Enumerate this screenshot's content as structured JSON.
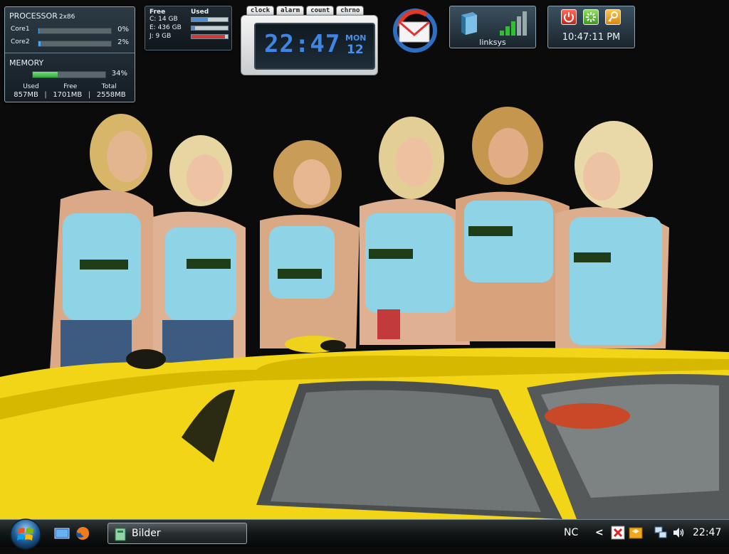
{
  "gadgets": {
    "cpu_meter": {
      "title": "PROCESSOR",
      "arch": "2x86",
      "cores": [
        {
          "label": "Core1",
          "percent": "0%",
          "value": 0
        },
        {
          "label": "Core2",
          "percent": "2%",
          "value": 2
        }
      ],
      "memory_title": "MEMORY",
      "memory_percent": "34%",
      "memory_value": 34,
      "used_label": "Used",
      "free_label": "Free",
      "total_label": "Total",
      "used": "857MB",
      "free": "1701MB",
      "total": "2558MB",
      "separator": "|"
    },
    "drive_meter": {
      "free_header": "Free",
      "used_header": "Used",
      "drives": [
        {
          "label": "C: 14 GB",
          "used_fraction": 0.45
        },
        {
          "label": "E: 436 GB",
          "used_fraction": 0.1
        },
        {
          "label": "J: 9 GB",
          "used_fraction": 0.92
        }
      ]
    },
    "clock": {
      "tabs": [
        "clock",
        "alarm",
        "count",
        "chrno"
      ],
      "time": "22:47",
      "day": "MON",
      "date": "12"
    },
    "wireless": {
      "network": "linksys"
    },
    "power": {
      "time": "10:47:11 PM"
    }
  },
  "taskbar": {
    "active_window": "Bilder",
    "tray_text": "NC",
    "tray_arrow": "<",
    "clock": "22:47"
  },
  "icons": {
    "start": "windows-orb-icon",
    "quicklaunch": [
      "show-desktop-icon",
      "firefox-icon"
    ],
    "window": "folder-icon",
    "tray": [
      "error-icon",
      "package-icon",
      "network-icon",
      "volume-icon"
    ]
  },
  "colors": {
    "meter_blue": "#4aa7ea",
    "memory_green": "#2ea53a",
    "clock_digits": "#3e86e6",
    "car_yellow": "#f2d516",
    "shirt_cyan": "#8fd3e6"
  }
}
